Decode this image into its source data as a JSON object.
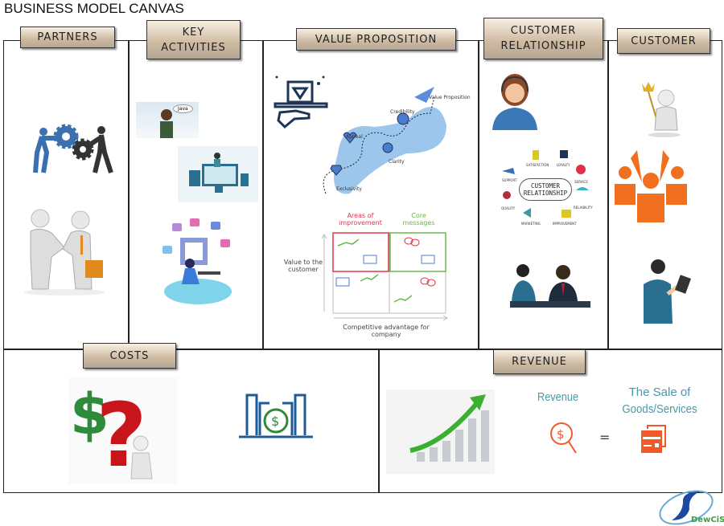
{
  "title": "BUSINESS MODEL CANVAS",
  "headers": {
    "partners": "PARTNERS",
    "key_activities_1": "KEY",
    "key_activities_2": "ACTIVITIES",
    "value_proposition": "VALUE PROPOSITION",
    "customer_relationship_1": "CUSTOMER",
    "customer_relationship_2": "RELATIONSHIP",
    "customer": "CUSTOMER",
    "costs": "COSTS",
    "revenue": "REVENUE"
  },
  "key_activities": {
    "speech": "Java"
  },
  "value_proposition": {
    "journey": {
      "value_proposition": "Value Proposition",
      "credibility": "Credibility",
      "appeal": "Appeal",
      "clarity": "Clarity",
      "exclusivity": "Exclusivity"
    },
    "matrix": {
      "areas_of_improvement": "Areas of improvement",
      "core_messages": "Core messages",
      "y_label": "Value to the customer",
      "x_label": "Competitive advantage for company",
      "colors": {
        "improvement": "#e0304a",
        "core": "#6ab84a",
        "icons": "#4a7bd0"
      }
    }
  },
  "customer_relationship": {
    "center": "CUSTOMER RELATIONSHIP",
    "labels": [
      "SATISFACTION",
      "LOYALTY",
      "SUPPORT",
      "SERVICE",
      "QUALITY",
      "RELIABILITY",
      "MARKETING",
      "IMPROVEMENT"
    ]
  },
  "revenue": {
    "revenue_label": "Revenue",
    "equals": "=",
    "sale_line1": "The Sale of",
    "sale_line2": "Goods/Services",
    "text_color": "#4a9aa8",
    "icon_color": "#f05a28"
  },
  "logo": {
    "text": "DewCiS"
  }
}
